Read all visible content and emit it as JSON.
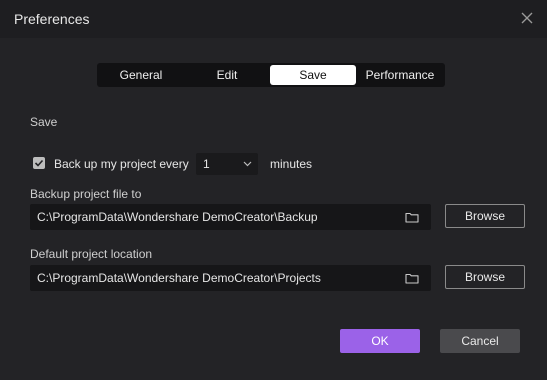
{
  "window": {
    "title": "Preferences"
  },
  "tabs": [
    {
      "label": "General"
    },
    {
      "label": "Edit"
    },
    {
      "label": "Save",
      "active": true
    },
    {
      "label": "Performance"
    }
  ],
  "save": {
    "section_title": "Save",
    "backup_checkbox": {
      "label": "Back up my project every",
      "checked": true
    },
    "interval_select": {
      "value": "1"
    },
    "interval_unit": "minutes",
    "backup_path": {
      "label": "Backup project file to",
      "value": "C:\\ProgramData\\Wondershare DemoCreator\\Backup",
      "browse_label": "Browse"
    },
    "default_location": {
      "label": "Default project location",
      "value": "C:\\ProgramData\\Wondershare DemoCreator\\Projects",
      "browse_label": "Browse"
    }
  },
  "footer": {
    "ok_label": "OK",
    "cancel_label": "Cancel"
  },
  "colors": {
    "accent": "#9b62e8",
    "background": "#232326",
    "titlebar": "#1e1e21"
  },
  "icons": {
    "close": "close-icon",
    "check": "check-icon",
    "chevron": "chevron-down-icon",
    "folder": "folder-icon"
  }
}
